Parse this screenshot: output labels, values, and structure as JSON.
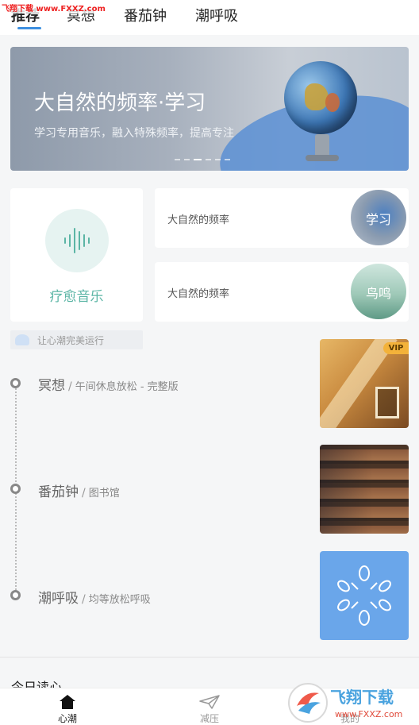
{
  "top_tabs": [
    {
      "label": "推荐"
    },
    {
      "label": "冥想"
    },
    {
      "label": "番茄钟"
    },
    {
      "label": "潮呼吸"
    }
  ],
  "watermark_top": "飞翔下载 www.FXXZ.com",
  "banner": {
    "title": "大自然的频率·学习",
    "subtitle": "学习专用音乐，融入特殊频率，提高专注"
  },
  "healing": {
    "label": "疗愈音乐"
  },
  "freq_cards": [
    {
      "label": "大自然的频率",
      "thumb": "学习"
    },
    {
      "label": "大自然的频率",
      "thumb": "鸟鸣"
    }
  ],
  "notice": {
    "text": "让心潮完美运行"
  },
  "timeline": [
    {
      "title": "冥想",
      "sep": "/",
      "sub": "午间休息放松 - 完整版",
      "badge": "VIP"
    },
    {
      "title": "番茄钟",
      "sep": "/",
      "sub": "图书馆"
    },
    {
      "title": "潮呼吸",
      "sep": "/",
      "sub": "均等放松呼吸"
    }
  ],
  "section": {
    "title": "今日读心"
  },
  "bottom_nav": [
    {
      "label": "心潮",
      "icon": "home-icon"
    },
    {
      "label": "减压",
      "icon": "paper-plane-icon"
    },
    {
      "label": "我的",
      "icon": "user-icon"
    }
  ],
  "watermark_logo": {
    "brand": "飞翔下载",
    "url": "www.FXXZ.com"
  },
  "colors": {
    "accent": "#3d8fe0",
    "teal": "#5bb5a5",
    "breath_card": "#6aa6ea"
  }
}
